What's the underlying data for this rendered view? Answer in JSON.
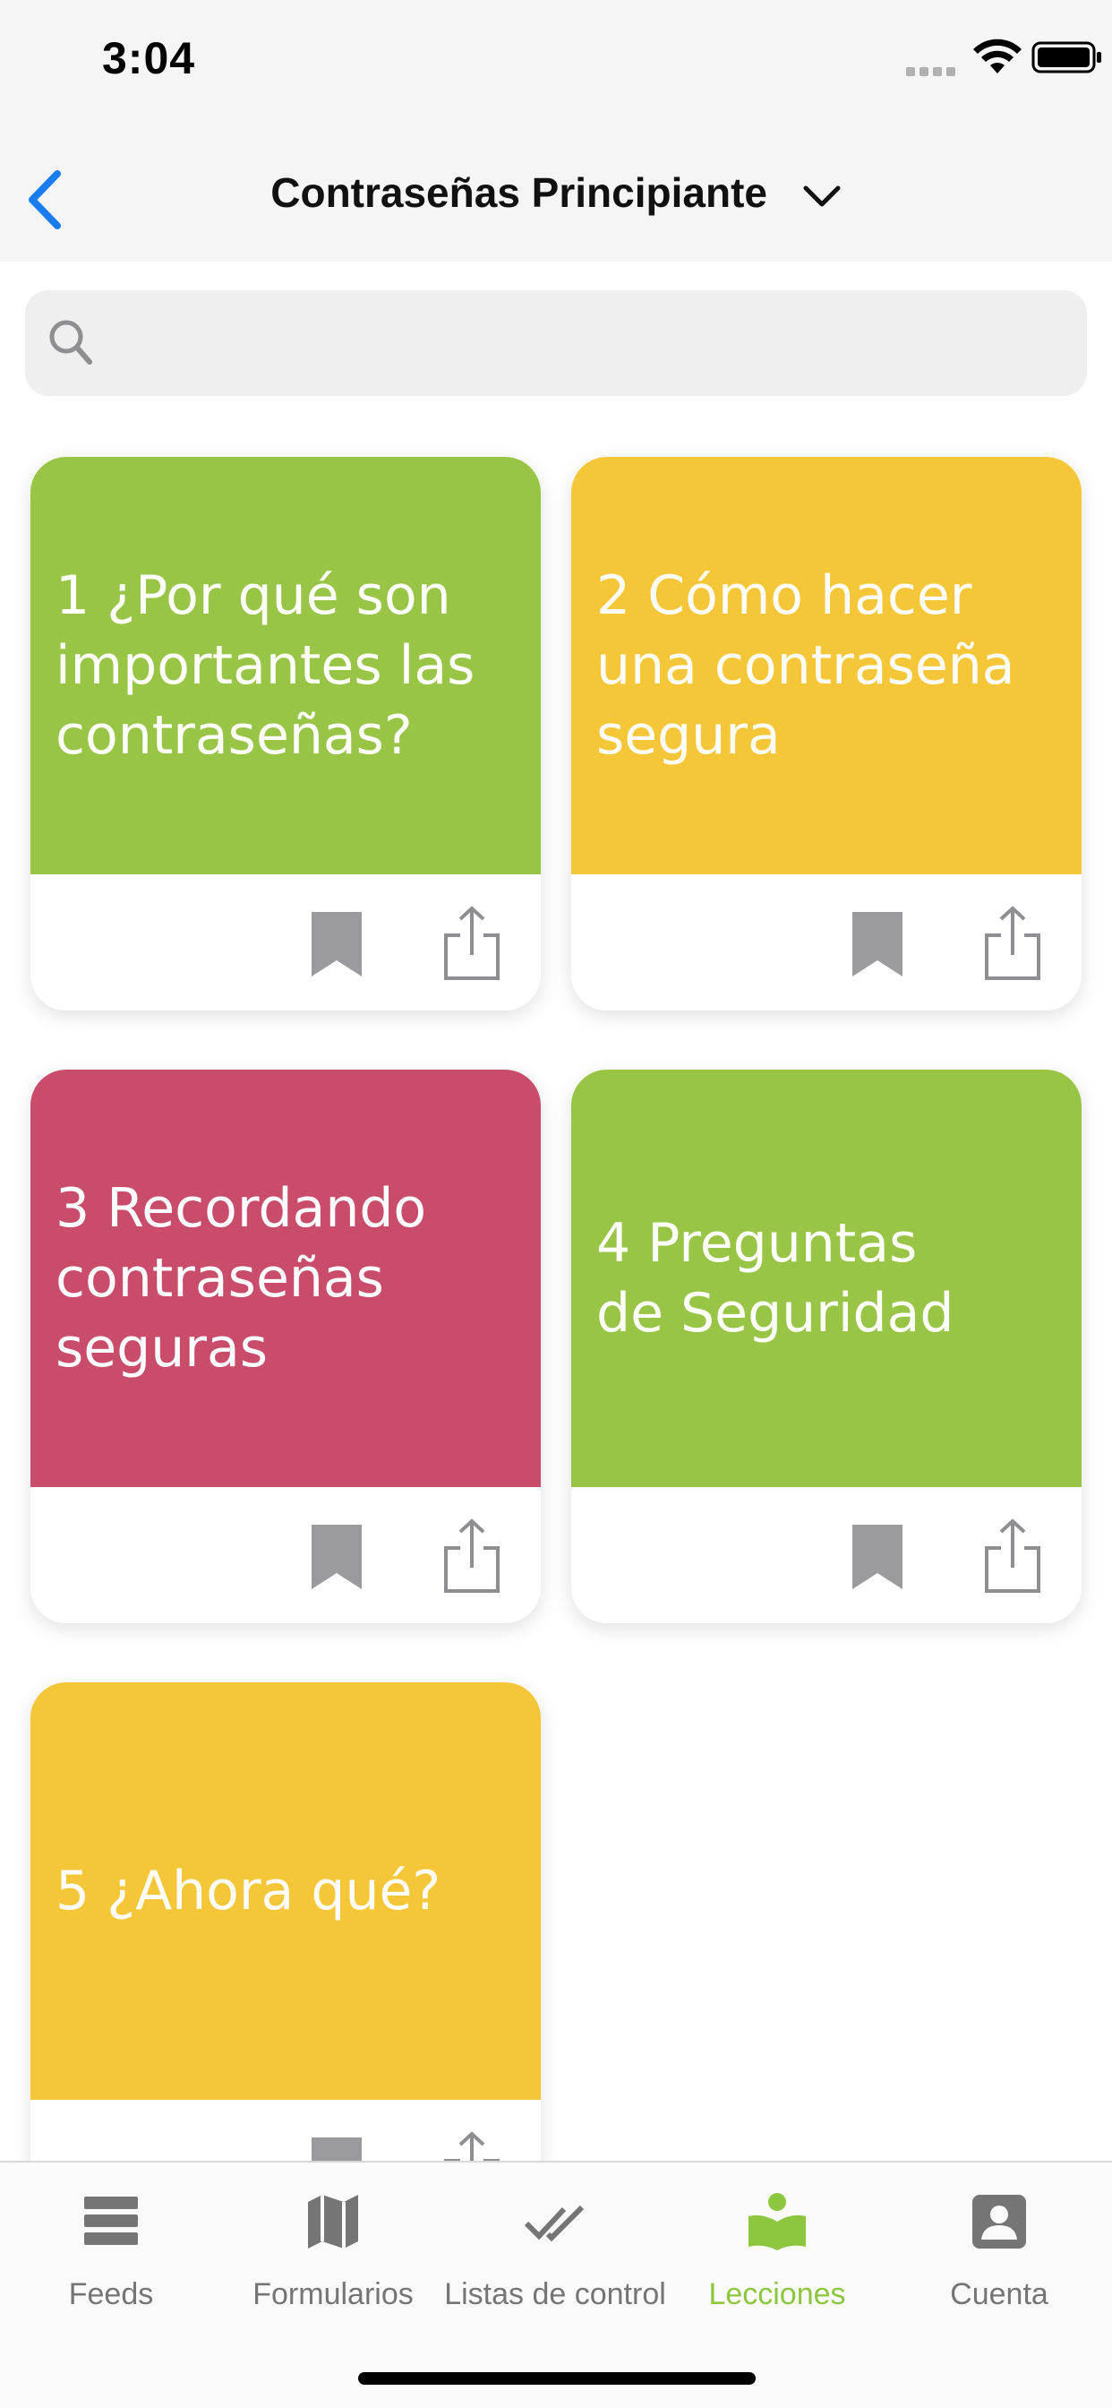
{
  "status_bar": {
    "time": "3:04"
  },
  "nav": {
    "title": "Contraseñas Principiante"
  },
  "search": {
    "placeholder": "",
    "value": ""
  },
  "lessons": [
    {
      "title": "1 ¿Por qué son\nimportantes las\ncontraseñas?",
      "color": "#98c546"
    },
    {
      "title": "2 Cómo hacer\nuna contraseña\nsegura",
      "color": "#f5c637"
    },
    {
      "title": "3 Recordando\ncontraseñas\nseguras",
      "color": "#c94d6b"
    },
    {
      "title": "4 Preguntas\nde Seguridad",
      "color": "#98c546"
    },
    {
      "title": "5 ¿Ahora qué?",
      "color": "#f5c637"
    }
  ],
  "tabs": [
    {
      "label": "Feeds",
      "icon": "feeds-icon"
    },
    {
      "label": "Formularios",
      "icon": "map-icon"
    },
    {
      "label": "Listas de control",
      "icon": "double-check-icon"
    },
    {
      "label": "Lecciones",
      "icon": "lesson-book-icon",
      "active": true
    },
    {
      "label": "Cuenta",
      "icon": "account-icon"
    }
  ],
  "colors": {
    "accent": "#8dc63f",
    "back": "#1a7cf2",
    "icon_gray": "#9b9b9f"
  }
}
